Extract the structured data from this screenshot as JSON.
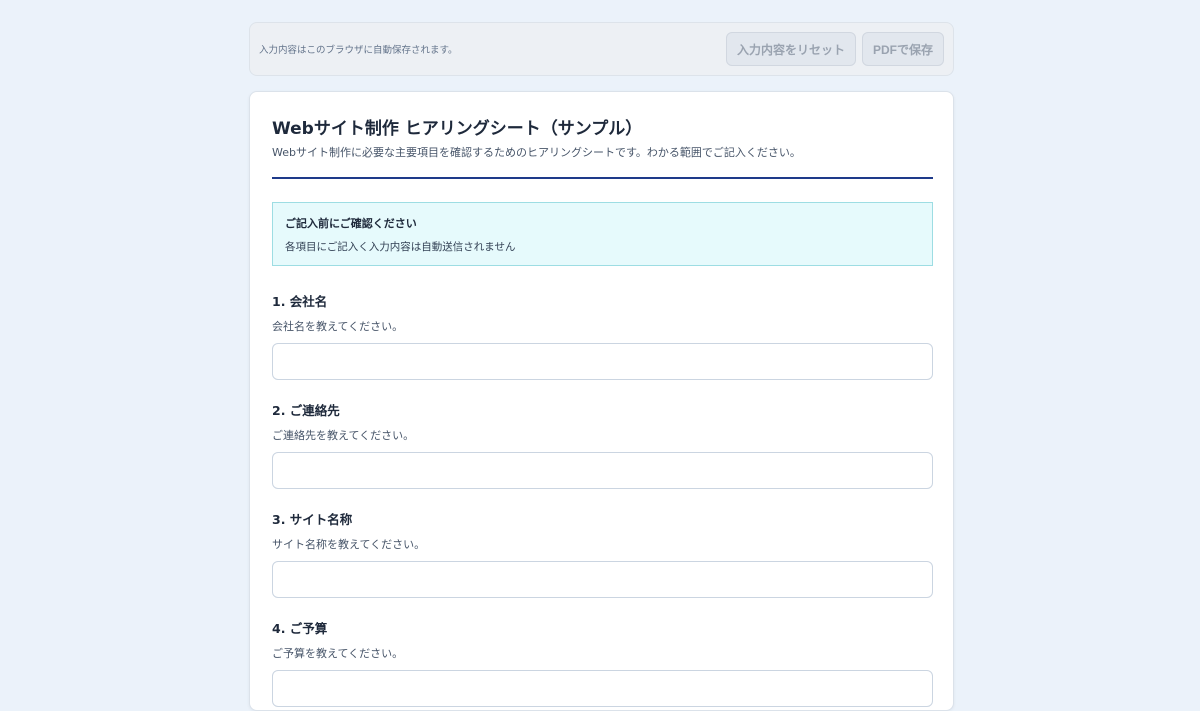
{
  "toolbar": {
    "note": "入力内容はこのブラウザに自動保存されます。",
    "reset_label": "入力内容をリセット",
    "pdf_label": "PDFで保存"
  },
  "form": {
    "title": "Webサイト制作 ヒアリングシート（サンプル）",
    "subtitle": "Webサイト制作に必要な主要項目を確認するためのヒアリングシートです。わかる範囲でご記入ください。",
    "notice": {
      "title": "ご記入前にご確認ください",
      "body": "各項目にご記入く入力内容は自動送信されません"
    },
    "questions": [
      {
        "label": "1. 会社名",
        "help": "会社名を教えてください。",
        "value": ""
      },
      {
        "label": "2. ご連絡先",
        "help": "ご連絡先を教えてください。",
        "value": ""
      },
      {
        "label": "3. サイト名称",
        "help": "サイト名称を教えてください。",
        "value": ""
      },
      {
        "label": "4. ご予算",
        "help": "ご予算を教えてください。",
        "value": ""
      }
    ]
  },
  "colors": {
    "page_bg": "#ebf2fa",
    "accent_rule": "#1e3a8a",
    "notice_bg": "#e6fafc",
    "notice_border": "#9ddde3"
  }
}
